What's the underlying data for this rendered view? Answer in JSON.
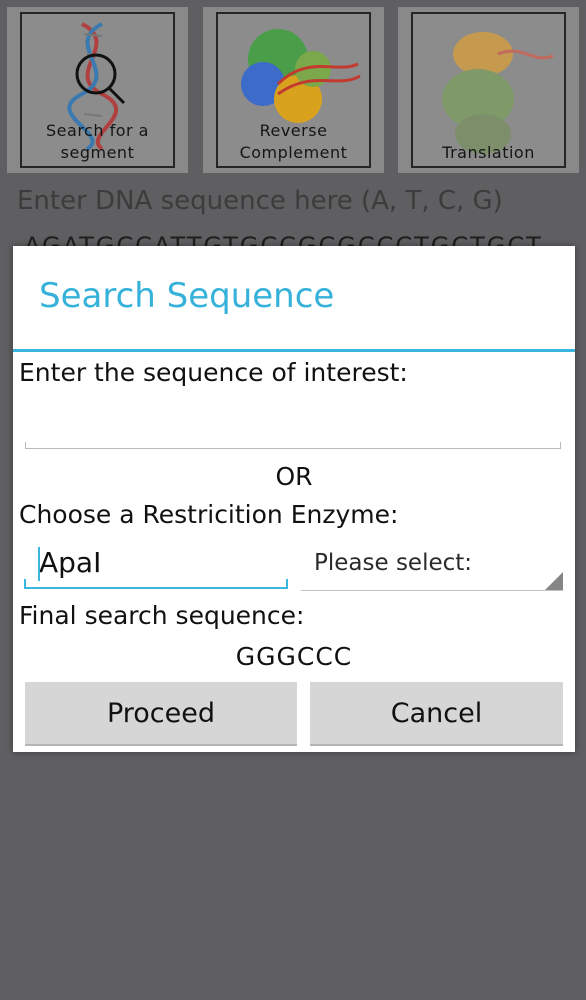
{
  "background": {
    "tiles": [
      {
        "label_line1": "Search for a",
        "label_line2": "segment",
        "icon": "dna-magnifier-icon"
      },
      {
        "label_line1": "Reverse",
        "label_line2": "Complement",
        "icon": "protein-dna-icon"
      },
      {
        "label_line1": "",
        "label_line2": "Translation",
        "icon": "protein-structure-icon"
      }
    ],
    "input_placeholder": "Enter DNA sequence here (A, T, C, G)",
    "sequence_preview": "AGATGCCATTGTGCCGCGCCCTGCTGCT"
  },
  "dialog": {
    "title": "Search Sequence",
    "sequence_label": "Enter the sequence of interest:",
    "sequence_value": "",
    "or_label": "OR",
    "enzyme_label": "Choose a Restricition Enzyme:",
    "enzyme_value": "ApaI",
    "enzyme_select_value": "Please select:",
    "final_label": "Final search sequence:",
    "final_sequence": "GGGCCC",
    "proceed_label": "Proceed",
    "cancel_label": "Cancel"
  },
  "colors": {
    "accent": "#36b2da",
    "overlay": "#5f5e60",
    "button": "#d6d6d6"
  }
}
